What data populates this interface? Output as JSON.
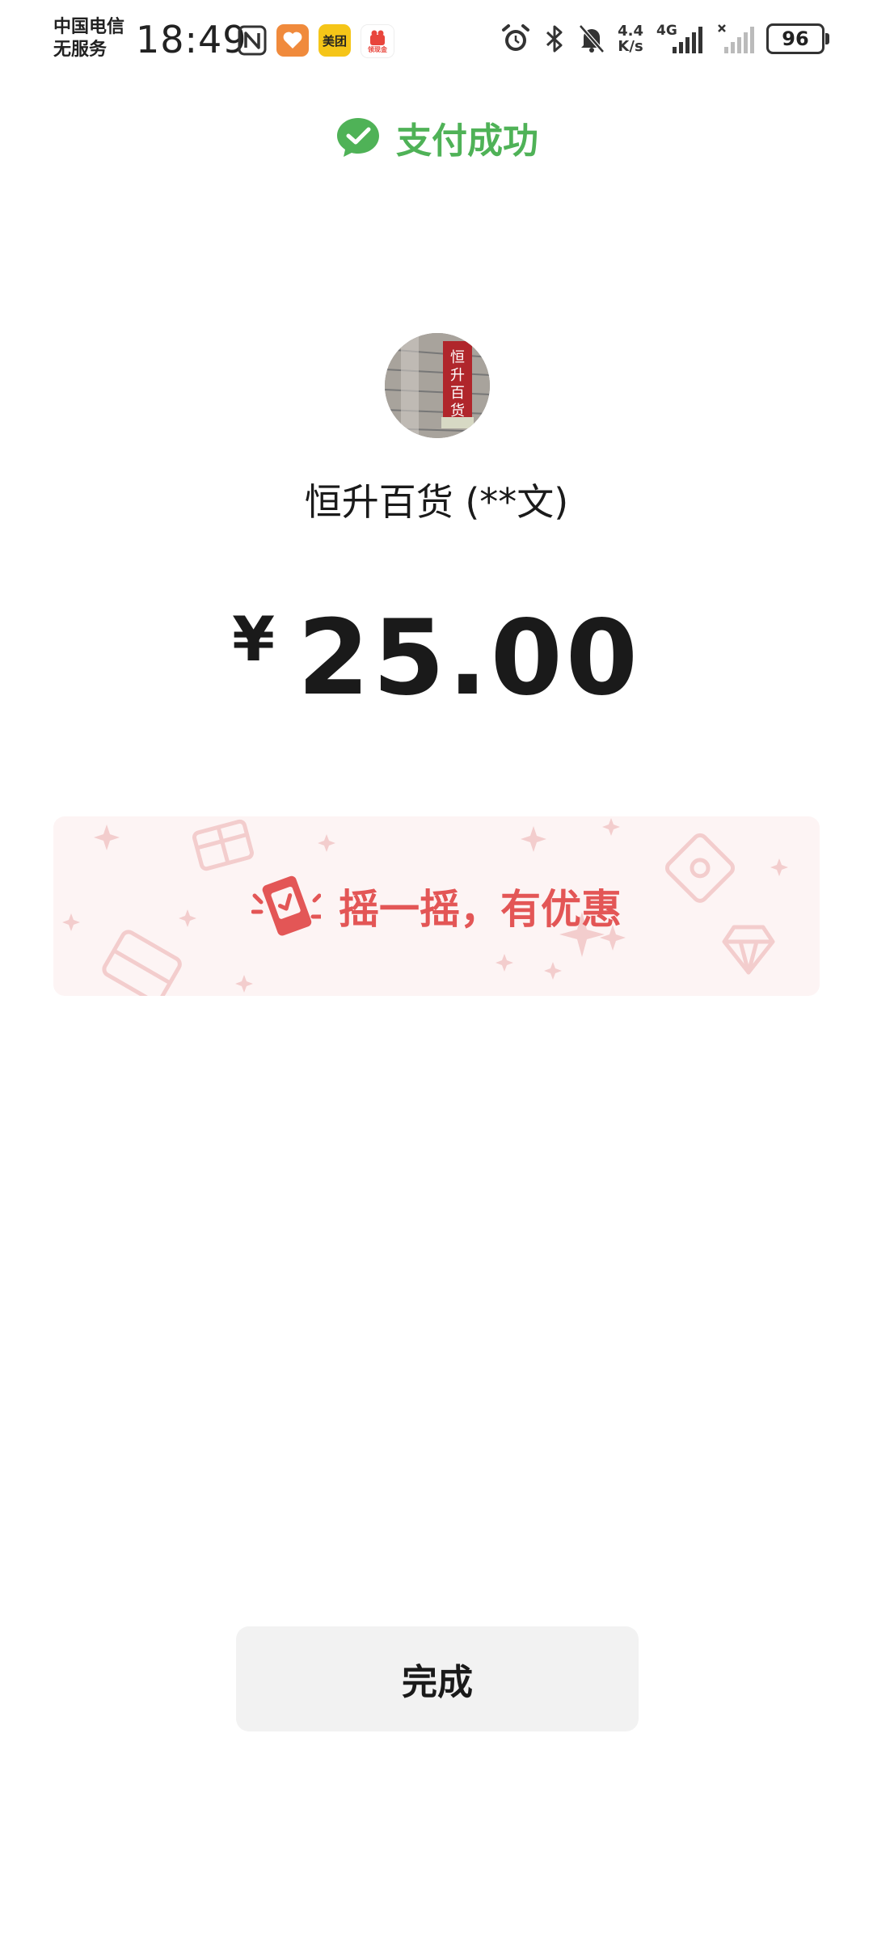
{
  "status_bar": {
    "carrier_line1": "中国电信",
    "carrier_line2": "无服务",
    "time": "18:49",
    "meituan_label": "美团",
    "app_badge_label": "领现金",
    "speed_value": "4.4",
    "speed_unit": "K/s",
    "network": "4G",
    "battery": "96"
  },
  "header": {
    "status_text": "支付成功",
    "accent_color": "#4fb257"
  },
  "payment": {
    "merchant_name": "恒升百货 (**文)",
    "sign_text": [
      "恒",
      "升",
      "百",
      "货"
    ],
    "currency_symbol": "¥",
    "amount": "25.00"
  },
  "promo": {
    "text": "摇一摇，有优惠",
    "color": "#e35656"
  },
  "actions": {
    "done_label": "完成"
  }
}
